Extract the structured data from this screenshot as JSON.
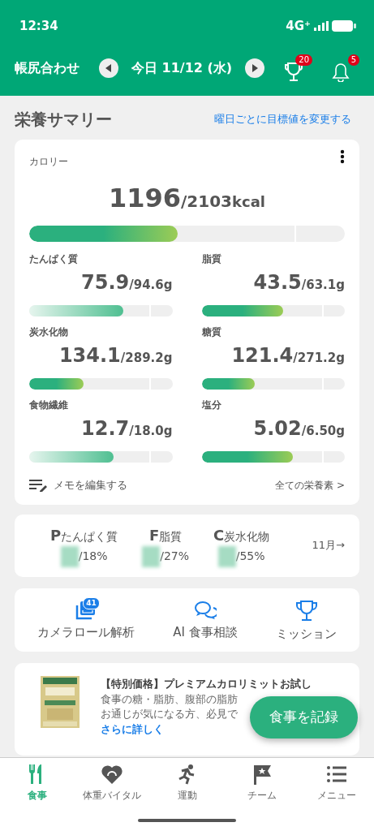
{
  "status_bar": {
    "time": "12:34",
    "network": "4G⁺"
  },
  "header": {
    "title": "帳尻合わせ",
    "date": "今日 11/12 (水)",
    "trophy_badge": "20",
    "bell_badge": "5"
  },
  "summary": {
    "title": "栄養サマリー",
    "link": "曜日ごとに目標値を変更する"
  },
  "calorie": {
    "label": "カロリー",
    "value": "1196",
    "target": "/2103",
    "unit": "kcal",
    "level": 0.47
  },
  "nutrients": [
    {
      "name": "たんぱく質",
      "value": "75.9",
      "target": "/94.6g",
      "level": 0.66,
      "kind": "light"
    },
    {
      "name": "脂質",
      "value": "43.5",
      "target": "/63.1g",
      "level": 0.57,
      "kind": "solid"
    },
    {
      "name": "炭水化物",
      "value": "134.1",
      "target": "/289.2g",
      "level": 0.38,
      "kind": "solid"
    },
    {
      "name": "糖質",
      "value": "121.4",
      "target": "/271.2g",
      "level": 0.37,
      "kind": "solid"
    },
    {
      "name": "食物繊維",
      "value": "12.7",
      "target": "/18.0g",
      "level": 0.59,
      "kind": "light"
    },
    {
      "name": "塩分",
      "value": "5.02",
      "target": "/6.50g",
      "level": 0.64,
      "kind": "solid"
    }
  ],
  "memo_link": "メモを編集する",
  "all_nutrients_link": "全ての栄養素 >",
  "pfc": {
    "items": [
      {
        "letter": "P",
        "name": "たんぱく質",
        "target": "/18%"
      },
      {
        "letter": "F",
        "name": "脂質",
        "target": "/27%"
      },
      {
        "letter": "C",
        "name": "炭水化物",
        "target": "/55%"
      }
    ],
    "month_link": "11月→"
  },
  "shortcuts": [
    {
      "kind": "camera",
      "label": "カメラロール解析",
      "badge": "41"
    },
    {
      "kind": "chat",
      "label": "AI 食事相談"
    },
    {
      "kind": "trophy",
      "label": "ミッション"
    }
  ],
  "ad": {
    "title": "【特別価格】プレミアムカロリミットお試し",
    "lines": [
      "食事の糖・脂肪、腹部の脂肪",
      "お通じが気になる方、必見で"
    ],
    "link": "さらに詳しく"
  },
  "fab": "食事を記録",
  "tabs": [
    {
      "kind": "meal",
      "label": "食事",
      "selected": true
    },
    {
      "kind": "heart",
      "label": "体重バイタル",
      "selected": false
    },
    {
      "kind": "run",
      "label": "運動",
      "selected": false
    },
    {
      "kind": "flag",
      "label": "チーム",
      "selected": false
    },
    {
      "kind": "menu",
      "label": "メニュー",
      "selected": false
    }
  ]
}
